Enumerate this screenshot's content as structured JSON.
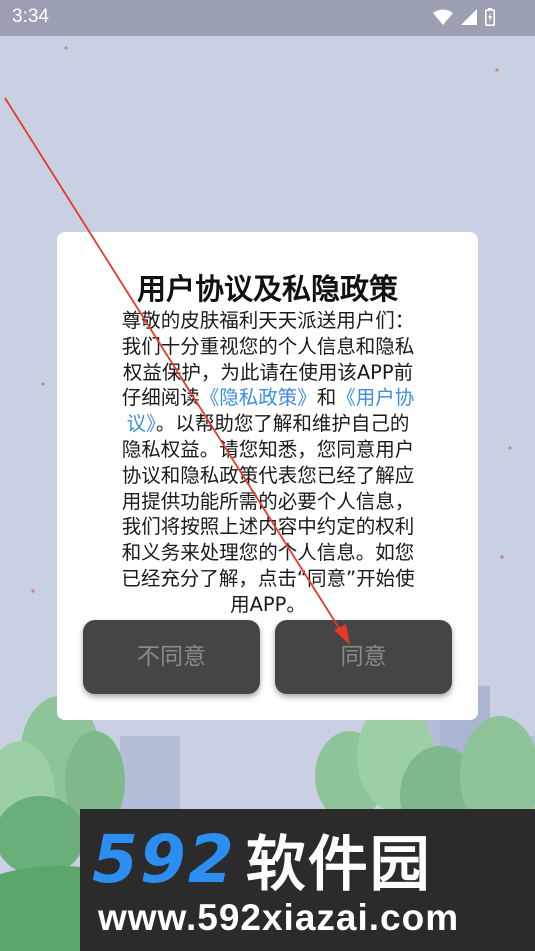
{
  "status_bar": {
    "time": "3:34",
    "icons": [
      "wifi-icon",
      "signal-icon",
      "battery-icon"
    ]
  },
  "dialog": {
    "title": "用户协议及私隐政策",
    "body_lines": [
      "尊敬的皮肤福利天天派送用户们：",
      "我们十分重视您的个人信息和隐私",
      "权益保护，为此请在使用该APP前"
    ],
    "body_line4_prefix": "仔细阅读",
    "privacy_link_text": "《隐私政策》",
    "and_text": "和",
    "agreement_link_part1": "《用户协",
    "agreement_link_part2": "议》",
    "body_line5_suffix": "。以帮助您了解和维护自己的",
    "body_lines_after": [
      "隐私权益。请您知悉，您同意用户",
      "协议和隐私政策代表您已经了解应",
      "用提供功能所需的必要个人信息，",
      "我们将按照上述内容中约定的权利",
      "和义务来处理您的个人信息。如您",
      "已经充分了解，点击“同意”开始使",
      "用APP。"
    ],
    "disagree_label": "不同意",
    "agree_label": "同意"
  },
  "watermark": {
    "number": "592",
    "name": "软件园",
    "url": "www.592xiazai.com"
  },
  "colors": {
    "background": "#c9d0e4",
    "status_bar": "#9aa0b2",
    "dialog": "#ffffff",
    "link": "#3d8de0",
    "button": "#454545",
    "button_text": "#8a8a8a",
    "annotation_arrow": "#e53a2a",
    "watermark_bg": "#2b2b2b",
    "watermark_number": "#2b8ef0"
  }
}
